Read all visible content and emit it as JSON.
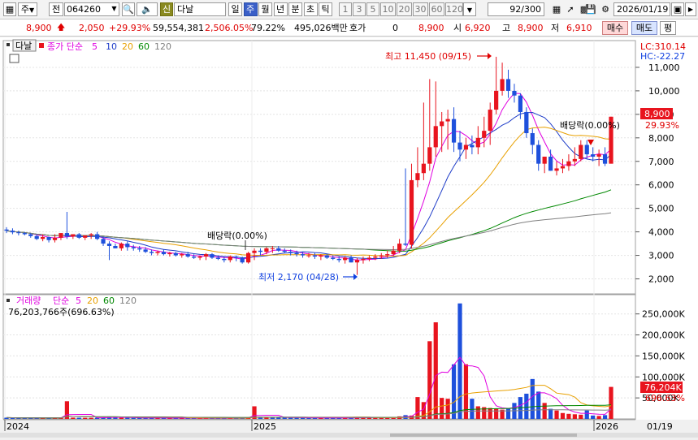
{
  "toolbar": {
    "market_select": "주",
    "code_type": "전",
    "stock_code": "064260",
    "shin_badge": "신",
    "stock_name": "다날",
    "periods": [
      "일",
      "주",
      "월",
      "년",
      "분",
      "초",
      "틱"
    ],
    "active_period": "주",
    "intervals": [
      "1",
      "3",
      "5",
      "10",
      "20",
      "30",
      "60",
      "120"
    ],
    "page_count": "92/300",
    "date": "2026/01/19"
  },
  "quote": {
    "price": "8,900",
    "change": "2,050",
    "change_pct": "+29.93%",
    "volume": "59,554,381",
    "volume_pct": "2,506.05%",
    "ratio": "79.22%",
    "amount": "495,026백만",
    "hoga_label": "호가",
    "hoga_value": "0",
    "hoga_price": "8,900",
    "open_label": "시",
    "open": "6,920",
    "high_label": "고",
    "high": "8,900",
    "low_label": "저",
    "low": "6,910",
    "buy_label": "매수",
    "sell_label": "매도",
    "extra_label": "평"
  },
  "price_panel": {
    "tab_name": "다날",
    "ma_title": "종가 단순",
    "ma_periods": [
      "5",
      "10",
      "20",
      "60",
      "120"
    ],
    "lc_label": "LC:310.14",
    "hc_label": "HC:-22.27",
    "high_annotation": "최고 11,450 (09/15)",
    "low_annotation": "최저 2,170 (04/28)",
    "dividend_label_1": "배당락(0.00%)",
    "dividend_label_2": "배당락(0.00%)",
    "last_price_tag": "8,900",
    "last_pct_tag": "29.93%"
  },
  "volume_panel": {
    "title": "거래량",
    "ma_title": "단순",
    "ma_periods": [
      "5",
      "20",
      "60",
      "120"
    ],
    "current_volume": "76,203,766주(696.63%)",
    "last_volume_tag": "76,204K",
    "last_pct_tag": "696.63%"
  },
  "x_axis": {
    "labels": [
      "2024",
      "2025",
      "2026"
    ],
    "date_label": "01/19"
  },
  "chart_data": [
    {
      "type": "candlestick",
      "title": "다날",
      "ylabel": "",
      "ylim": [
        1500,
        12000
      ],
      "y_ticks": [
        2000,
        3000,
        4000,
        5000,
        6000,
        7000,
        8000,
        9000,
        10000,
        11000
      ],
      "x": [
        0,
        1,
        2,
        3,
        4,
        5,
        6,
        7,
        8,
        9,
        10,
        11,
        12,
        13,
        14,
        15,
        16,
        17,
        18,
        19,
        20,
        21,
        22,
        23,
        24,
        25,
        26,
        27,
        28,
        29,
        30,
        31,
        32,
        33,
        34,
        35,
        36,
        37,
        38,
        39,
        40,
        41,
        42,
        43,
        44,
        45,
        46,
        47,
        48,
        49,
        50,
        51,
        52,
        53,
        54,
        55,
        56,
        57,
        58,
        59,
        60,
        61,
        62,
        63,
        64,
        65,
        66,
        67,
        68,
        69,
        70,
        71,
        72,
        73,
        74,
        75,
        76,
        77,
        78,
        79,
        80,
        81,
        82,
        83,
        84,
        85,
        86,
        87,
        88,
        89,
        90,
        91,
        92,
        93,
        94,
        95,
        96,
        97,
        98,
        99,
        100,
        101,
        102,
        103,
        104,
        105,
        106,
        107,
        108,
        109,
        110,
        111,
        112,
        113,
        114,
        115,
        116,
        117,
        118,
        119,
        120
      ],
      "open": [
        4100,
        4050,
        3980,
        3950,
        3900,
        3820,
        3700,
        3780,
        3650,
        3750,
        3950,
        3800,
        3900,
        3750,
        3850,
        3900,
        3700,
        3500,
        3400,
        3300,
        3500,
        3350,
        3300,
        3250,
        3150,
        3100,
        3150,
        3050,
        3100,
        3000,
        3050,
        2950,
        2900,
        2950,
        3050,
        2900,
        2850,
        2800,
        2950,
        2900,
        2700,
        3100,
        3200,
        3150,
        3300,
        3300,
        3200,
        3150,
        3100,
        3050,
        3000,
        3000,
        2950,
        3000,
        2900,
        2850,
        2800,
        2900,
        2700,
        2800,
        2850,
        2900,
        2950,
        3000,
        3050,
        3200,
        3500,
        3450,
        6200,
        6500,
        6900,
        7600,
        8500,
        8700,
        8800,
        7800,
        7500,
        7700,
        7600,
        8000,
        8300,
        9200,
        10000,
        10500,
        10000,
        9800,
        9100,
        8200,
        7700,
        6900,
        7200,
        6600,
        6700,
        6800,
        7000,
        7100,
        7700,
        7300,
        7200,
        7300,
        6900
      ],
      "high": [
        4200,
        4150,
        4050,
        4000,
        3950,
        3900,
        3900,
        3800,
        3900,
        3900,
        4850,
        3900,
        3950,
        3850,
        3950,
        4000,
        3800,
        3600,
        3500,
        3550,
        3600,
        3450,
        3400,
        3350,
        3250,
        3200,
        3250,
        3150,
        3150,
        3100,
        3150,
        3050,
        3000,
        3100,
        3100,
        3000,
        2950,
        3000,
        3000,
        2950,
        3150,
        3300,
        3300,
        3350,
        3400,
        3400,
        3300,
        3250,
        3200,
        3150,
        3100,
        3100,
        3050,
        3050,
        3000,
        2950,
        2950,
        3000,
        2900,
        2950,
        3000,
        3050,
        3100,
        3200,
        3400,
        3700,
        6700,
        6900,
        7600,
        9500,
        10500,
        10400,
        9100,
        9200,
        9300,
        8300,
        8000,
        8100,
        8500,
        8900,
        9500,
        11450,
        11200,
        10900,
        10300,
        9900,
        9300,
        8400,
        7900,
        7200,
        7500,
        7000,
        7100,
        7300,
        7600,
        7900,
        7900,
        7600,
        7500,
        7600,
        8900
      ],
      "low": [
        3950,
        3900,
        3850,
        3850,
        3750,
        3650,
        3600,
        3550,
        3550,
        3650,
        3700,
        3700,
        3700,
        3650,
        3700,
        3650,
        3400,
        2800,
        3300,
        3200,
        3200,
        3200,
        3150,
        3100,
        3000,
        3000,
        3000,
        2950,
        2950,
        2900,
        2900,
        2850,
        2800,
        2800,
        2850,
        2800,
        2700,
        2700,
        2750,
        2650,
        2650,
        2800,
        3000,
        3050,
        3100,
        3150,
        3100,
        3000,
        2950,
        2900,
        2900,
        2850,
        2800,
        2850,
        2800,
        2700,
        2650,
        2700,
        2170,
        2650,
        2750,
        2800,
        2850,
        2900,
        2950,
        3100,
        3400,
        3300,
        5900,
        6200,
        6600,
        7200,
        7400,
        7500,
        7400,
        7000,
        7100,
        7300,
        7300,
        7600,
        7700,
        9000,
        9800,
        9700,
        9500,
        8800,
        8000,
        7300,
        6600,
        6500,
        6600,
        6400,
        6500,
        6600,
        6800,
        7000,
        7100,
        7000,
        6800,
        6800,
        6910
      ],
      "close": [
        4050,
        3980,
        3950,
        3900,
        3820,
        3700,
        3780,
        3650,
        3750,
        3950,
        3800,
        3900,
        3750,
        3850,
        3900,
        3700,
        3500,
        3400,
        3300,
        3500,
        3350,
        3300,
        3250,
        3150,
        3100,
        3150,
        3050,
        3100,
        3000,
        3050,
        2950,
        2900,
        2950,
        3050,
        2900,
        2850,
        2800,
        2950,
        2900,
        2700,
        3100,
        3200,
        3150,
        3300,
        3300,
        3200,
        3150,
        3100,
        3050,
        3000,
        3000,
        2950,
        3000,
        2900,
        2850,
        2800,
        2900,
        2700,
        2800,
        2850,
        2900,
        2950,
        3000,
        3050,
        3200,
        3500,
        3450,
        6200,
        6500,
        6900,
        7600,
        8500,
        8700,
        8800,
        7800,
        7500,
        7700,
        7600,
        8000,
        8300,
        9200,
        10000,
        10500,
        10000,
        9800,
        9100,
        8200,
        7700,
        6900,
        7200,
        6600,
        6700,
        6800,
        7000,
        7100,
        7700,
        7300,
        7200,
        7300,
        6900,
        8900
      ],
      "series": [
        {
          "name": "5",
          "color": "#e000e0"
        },
        {
          "name": "10",
          "color": "#1e3cc8"
        },
        {
          "name": "20",
          "color": "#e8a000"
        },
        {
          "name": "60",
          "color": "#008800"
        },
        {
          "name": "120",
          "color": "#808080"
        }
      ]
    },
    {
      "type": "bar",
      "title": "거래량",
      "ylim": [
        0,
        290000
      ],
      "y_ticks": [
        50000,
        100000,
        150000,
        200000,
        250000
      ],
      "y_tick_labels": [
        "50,000K",
        "100,000K",
        "150,000K",
        "200,000K",
        "250,000K"
      ],
      "values": [
        3000,
        2800,
        2500,
        2600,
        2400,
        2500,
        2300,
        2400,
        2300,
        2600,
        42000,
        3000,
        2800,
        2600,
        2700,
        2900,
        3200,
        6000,
        3100,
        2800,
        2700,
        2500,
        2400,
        2300,
        2200,
        2100,
        2300,
        2200,
        2100,
        2000,
        2100,
        2000,
        1900,
        2100,
        2000,
        1900,
        1800,
        2000,
        1900,
        3000,
        3500,
        30000,
        3600,
        3300,
        3500,
        3200,
        3000,
        2900,
        2800,
        2700,
        2600,
        2500,
        2400,
        2500,
        2300,
        2200,
        2300,
        2400,
        4500,
        3000,
        2800,
        2700,
        2900,
        3100,
        4200,
        6000,
        9000,
        8000,
        52000,
        40000,
        185000,
        230000,
        50000,
        48000,
        130000,
        275000,
        130000,
        48000,
        30000,
        28000,
        26000,
        25000,
        22000,
        24000,
        38000,
        52000,
        60000,
        95000,
        65000,
        38000,
        24000,
        20000,
        14000,
        12000,
        11000,
        10000,
        20000,
        8000,
        7000,
        9000,
        76204
      ],
      "up": [
        false,
        false,
        false,
        false,
        false,
        false,
        true,
        false,
        true,
        true,
        true,
        true,
        false,
        true,
        true,
        false,
        false,
        false,
        false,
        true,
        false,
        false,
        false,
        false,
        false,
        true,
        false,
        true,
        false,
        true,
        false,
        false,
        true,
        true,
        false,
        false,
        false,
        true,
        false,
        false,
        true,
        true,
        false,
        true,
        false,
        false,
        false,
        false,
        false,
        false,
        false,
        false,
        true,
        false,
        false,
        false,
        true,
        false,
        true,
        true,
        true,
        true,
        true,
        true,
        true,
        true,
        false,
        true,
        true,
        true,
        true,
        true,
        true,
        true,
        false,
        false,
        true,
        false,
        true,
        true,
        true,
        true,
        true,
        false,
        false,
        false,
        false,
        false,
        false,
        true,
        false,
        true,
        true,
        true,
        true,
        true,
        false,
        false,
        true,
        false,
        true
      ],
      "series": [
        {
          "name": "5",
          "color": "#e000e0"
        },
        {
          "name": "20",
          "color": "#e8a000"
        },
        {
          "name": "60",
          "color": "#008800"
        },
        {
          "name": "120",
          "color": "#808080"
        }
      ]
    }
  ],
  "colors": {
    "up": "#e8141e",
    "down": "#1e50dc",
    "accent_blue": "#1040e0",
    "accent_red": "#e00000"
  }
}
